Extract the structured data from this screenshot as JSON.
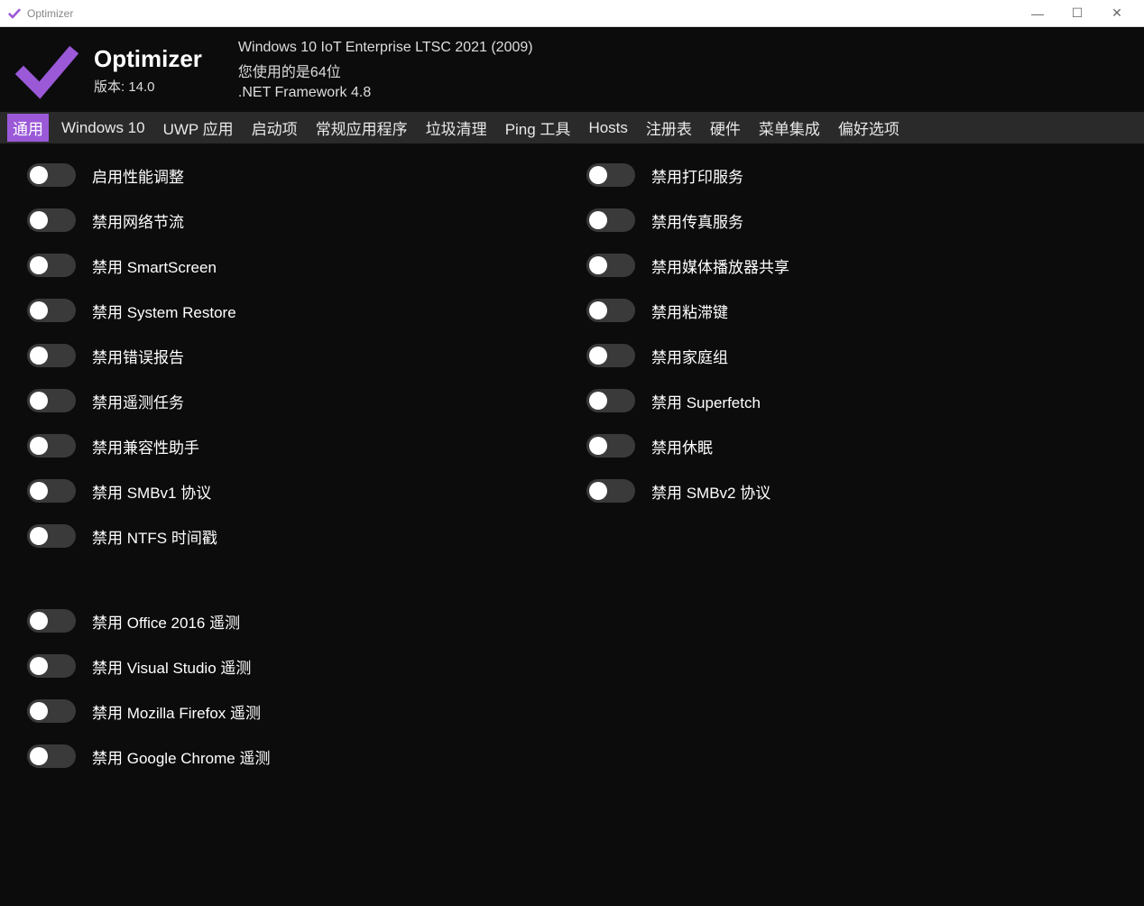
{
  "titlebar": {
    "title": "Optimizer"
  },
  "header": {
    "app_name": "Optimizer",
    "version_label": "版本: 14.0",
    "os_line": "Windows 10 IoT Enterprise LTSC 2021 (2009)",
    "arch_line": "您使用的是64位",
    "dotnet_line": ".NET Framework 4.8"
  },
  "tabs": [
    "通用",
    "Windows 10",
    "UWP 应用",
    "启动项",
    "常规应用程序",
    "垃圾清理",
    "Ping 工具",
    "Hosts",
    "注册表",
    "硬件",
    "菜单集成",
    "偏好选项"
  ],
  "active_tab_index": 0,
  "options_left": [
    "启用性能调整",
    "禁用网络节流",
    "禁用 SmartScreen",
    "禁用 System Restore",
    "禁用错误报告",
    "禁用遥测任务",
    "禁用兼容性助手",
    "禁用 SMBv1 协议",
    "禁用 NTFS 时间戳"
  ],
  "options_left_extra": [
    "禁用 Office 2016 遥测",
    "禁用 Visual Studio 遥测",
    "禁用 Mozilla Firefox 遥测",
    "禁用 Google Chrome 遥测"
  ],
  "options_right": [
    "禁用打印服务",
    "禁用传真服务",
    "禁用媒体播放器共享",
    "禁用粘滞键",
    "禁用家庭组",
    "禁用 Superfetch",
    "禁用休眠",
    "禁用 SMBv2 协议"
  ],
  "colors": {
    "accent": "#9b59d8"
  }
}
